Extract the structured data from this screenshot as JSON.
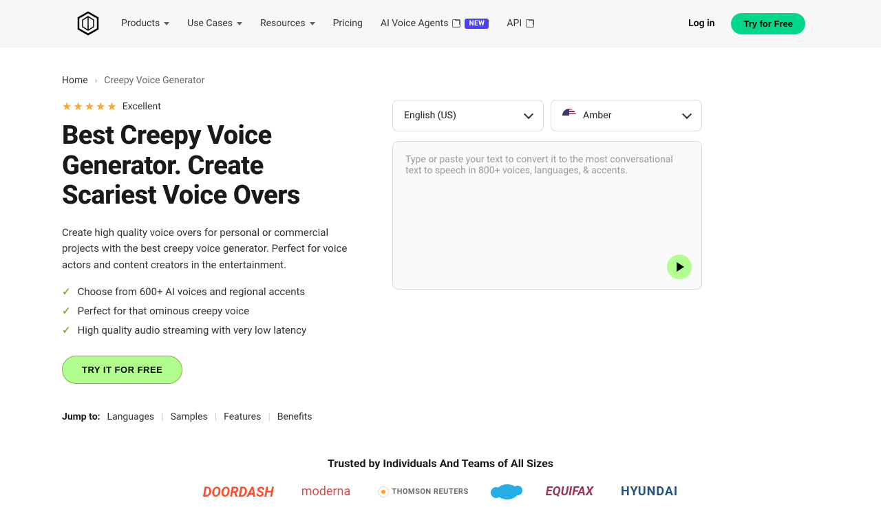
{
  "nav": {
    "products": "Products",
    "useCases": "Use Cases",
    "resources": "Resources",
    "pricing": "Pricing",
    "aiVoiceAgents": "AI Voice Agents",
    "newBadge": "NEW",
    "api": "API"
  },
  "header": {
    "login": "Log in",
    "tryFree": "Try for Free"
  },
  "breadcrumb": {
    "home": "Home",
    "current": "Creepy Voice Generator"
  },
  "hero": {
    "ratingLabel": "Excellent",
    "headline": "Best Creepy Voice Generator. Create Scariest Voice Overs",
    "description": "Create high quality voice overs for personal or commercial projects with the best creepy voice generator. Perfect for voice actors and content creators in the entertainment.",
    "features": [
      "Choose from 600+ AI voices and regional accents",
      "Perfect for that ominous creepy voice",
      "High quality audio streaming with very low latency"
    ],
    "cta": "TRY IT FOR FREE"
  },
  "jump": {
    "label": "Jump to:",
    "languages": "Languages",
    "samples": "Samples",
    "features": "Features",
    "benefits": "Benefits"
  },
  "widget": {
    "language": "English (US)",
    "voice": "Amber",
    "placeholder": "Type or paste your text to convert it to the most conversational text to speech in 800+ voices, languages, & accents."
  },
  "trusted": {
    "title": "Trusted by Individuals And Teams of All Sizes",
    "partners": {
      "doordash": "DOORDASH",
      "moderna": "moderna",
      "tr": "THOMSON REUTERS",
      "equifax": "EQUIFAX",
      "hyundai": "HYUNDAI"
    }
  }
}
